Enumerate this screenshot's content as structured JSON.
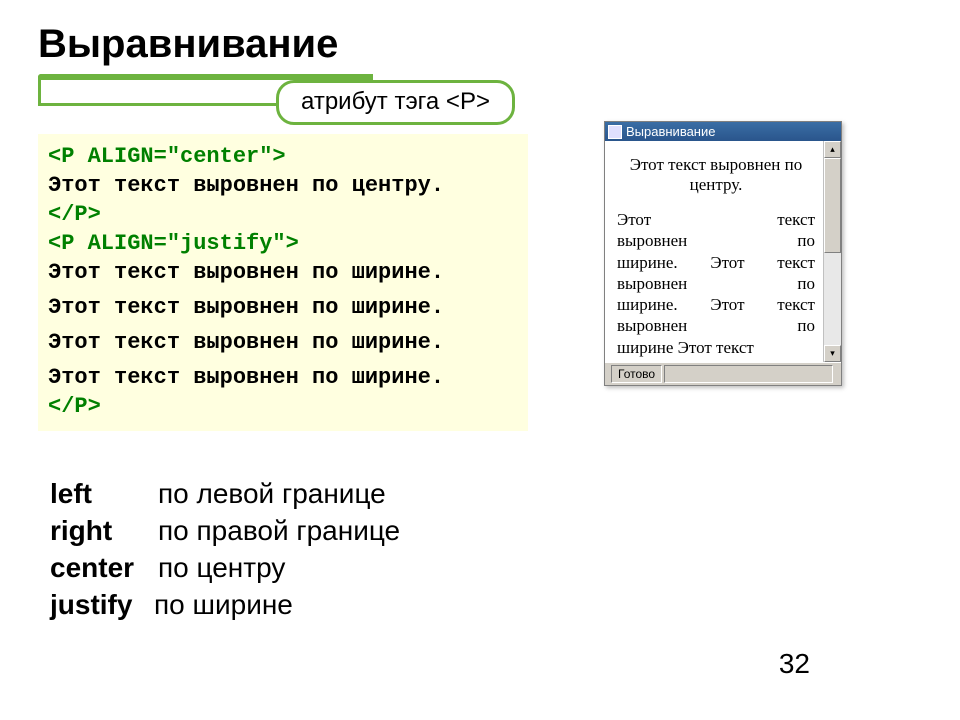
{
  "title": "Выравнивание",
  "callout": "атрибут тэга <P>",
  "code": {
    "l1": "<P ALIGN=\"center\">",
    "l2": "Этот текст выровнен по центру.",
    "l3": "</P>",
    "l4": "<P ALIGN=\"justify\">",
    "l5": "Этот текст выровнен по ширине.",
    "l6": "Этот текст выровнен по ширине.",
    "l7": "Этот текст выровнен по ширине.",
    "l8": "Этот текст выровнен по ширине.",
    "l9": "</P>"
  },
  "browser": {
    "title": "Выравнивание",
    "center_text": "Этот текст выровнен по центру.",
    "justify_l1": "Этот текст",
    "justify_l2": "выровнен по",
    "justify_l3": "ширине. Этот текст",
    "justify_l4": "выровнен по",
    "justify_l5": "ширине. Этот текст",
    "justify_l6": "выровнен по",
    "justify_l7": "ширине Этот текст",
    "status": "Готово"
  },
  "definitions": [
    {
      "key": "left",
      "desc": "по левой границе"
    },
    {
      "key": "right",
      "desc": "по правой границе"
    },
    {
      "key": "center",
      "desc": "по центру"
    },
    {
      "key": "justify",
      "desc": "по ширине"
    }
  ],
  "page_number": "32"
}
